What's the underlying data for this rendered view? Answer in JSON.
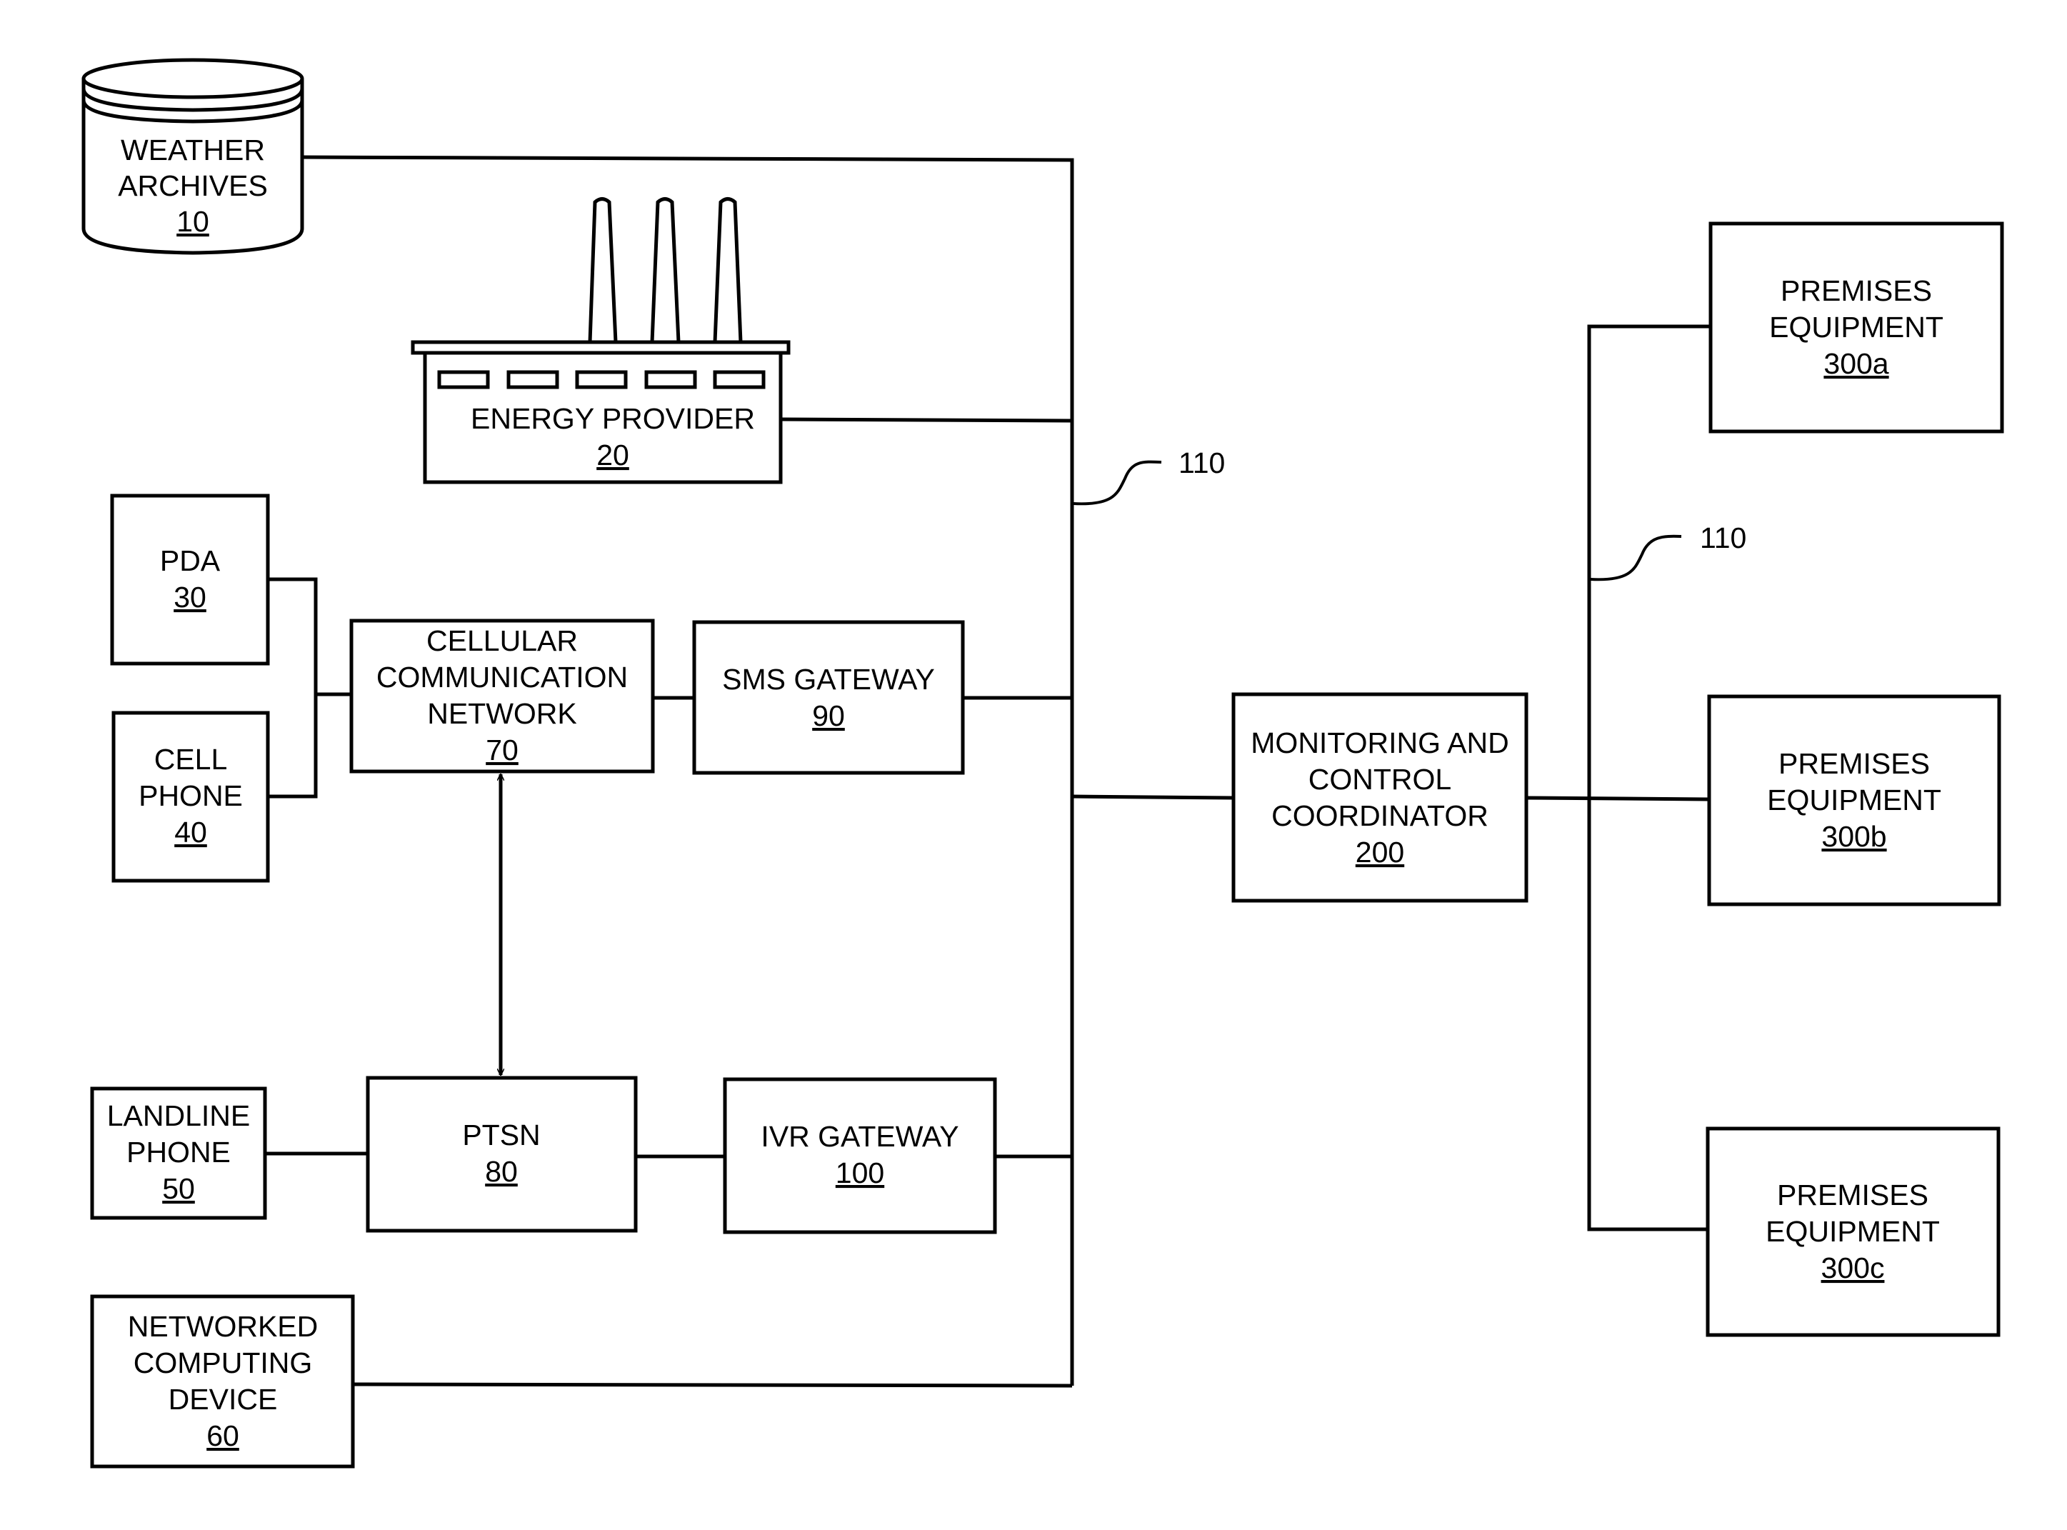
{
  "diagram": {
    "nodes": {
      "weather_archives": {
        "lines": [
          "WEATHER",
          "ARCHIVES"
        ],
        "ref": "10",
        "shape": "database-cylinder"
      },
      "energy_provider": {
        "lines": [
          "ENERGY PROVIDER"
        ],
        "ref": "20",
        "shape": "factory"
      },
      "pda": {
        "lines": [
          "PDA"
        ],
        "ref": "30"
      },
      "cell_phone": {
        "lines": [
          "CELL",
          "PHONE"
        ],
        "ref": "40"
      },
      "landline_phone": {
        "lines": [
          "LANDLINE",
          "PHONE"
        ],
        "ref": "50"
      },
      "networked_computing_device": {
        "lines": [
          "NETWORKED",
          "COMPUTING",
          "DEVICE"
        ],
        "ref": "60"
      },
      "cellular_network": {
        "lines": [
          "CELLULAR",
          "COMMUNICATION",
          "NETWORK"
        ],
        "ref": "70"
      },
      "ptsn": {
        "lines": [
          "PTSN"
        ],
        "ref": "80"
      },
      "sms_gateway": {
        "lines": [
          "SMS GATEWAY"
        ],
        "ref": "90"
      },
      "ivr_gateway": {
        "lines": [
          "IVR GATEWAY"
        ],
        "ref": "100"
      },
      "coordinator": {
        "lines": [
          "MONITORING AND",
          "CONTROL",
          "COORDINATOR"
        ],
        "ref": "200"
      },
      "premises_a": {
        "lines": [
          "PREMISES",
          "EQUIPMENT"
        ],
        "ref": "300a"
      },
      "premises_b": {
        "lines": [
          "PREMISES",
          "EQUIPMENT"
        ],
        "ref": "300b"
      },
      "premises_c": {
        "lines": [
          "PREMISES",
          "EQUIPMENT"
        ],
        "ref": "300c"
      }
    },
    "callouts": {
      "network_left": "110",
      "network_right": "110"
    },
    "edges": [
      {
        "from": "weather_archives",
        "to": "network_bus"
      },
      {
        "from": "energy_provider",
        "to": "network_bus"
      },
      {
        "from": "pda",
        "to": "cellular_network"
      },
      {
        "from": "cell_phone",
        "to": "cellular_network"
      },
      {
        "from": "cellular_network",
        "to": "sms_gateway"
      },
      {
        "from": "sms_gateway",
        "to": "network_bus"
      },
      {
        "from": "cellular_network",
        "to": "ptsn",
        "bidirectional": true
      },
      {
        "from": "landline_phone",
        "to": "ptsn"
      },
      {
        "from": "ptsn",
        "to": "ivr_gateway"
      },
      {
        "from": "ivr_gateway",
        "to": "network_bus"
      },
      {
        "from": "networked_computing_device",
        "to": "network_bus"
      },
      {
        "from": "network_bus",
        "to": "coordinator"
      },
      {
        "from": "coordinator",
        "to": "premises_a"
      },
      {
        "from": "coordinator",
        "to": "premises_b"
      },
      {
        "from": "coordinator",
        "to": "premises_c"
      }
    ]
  }
}
